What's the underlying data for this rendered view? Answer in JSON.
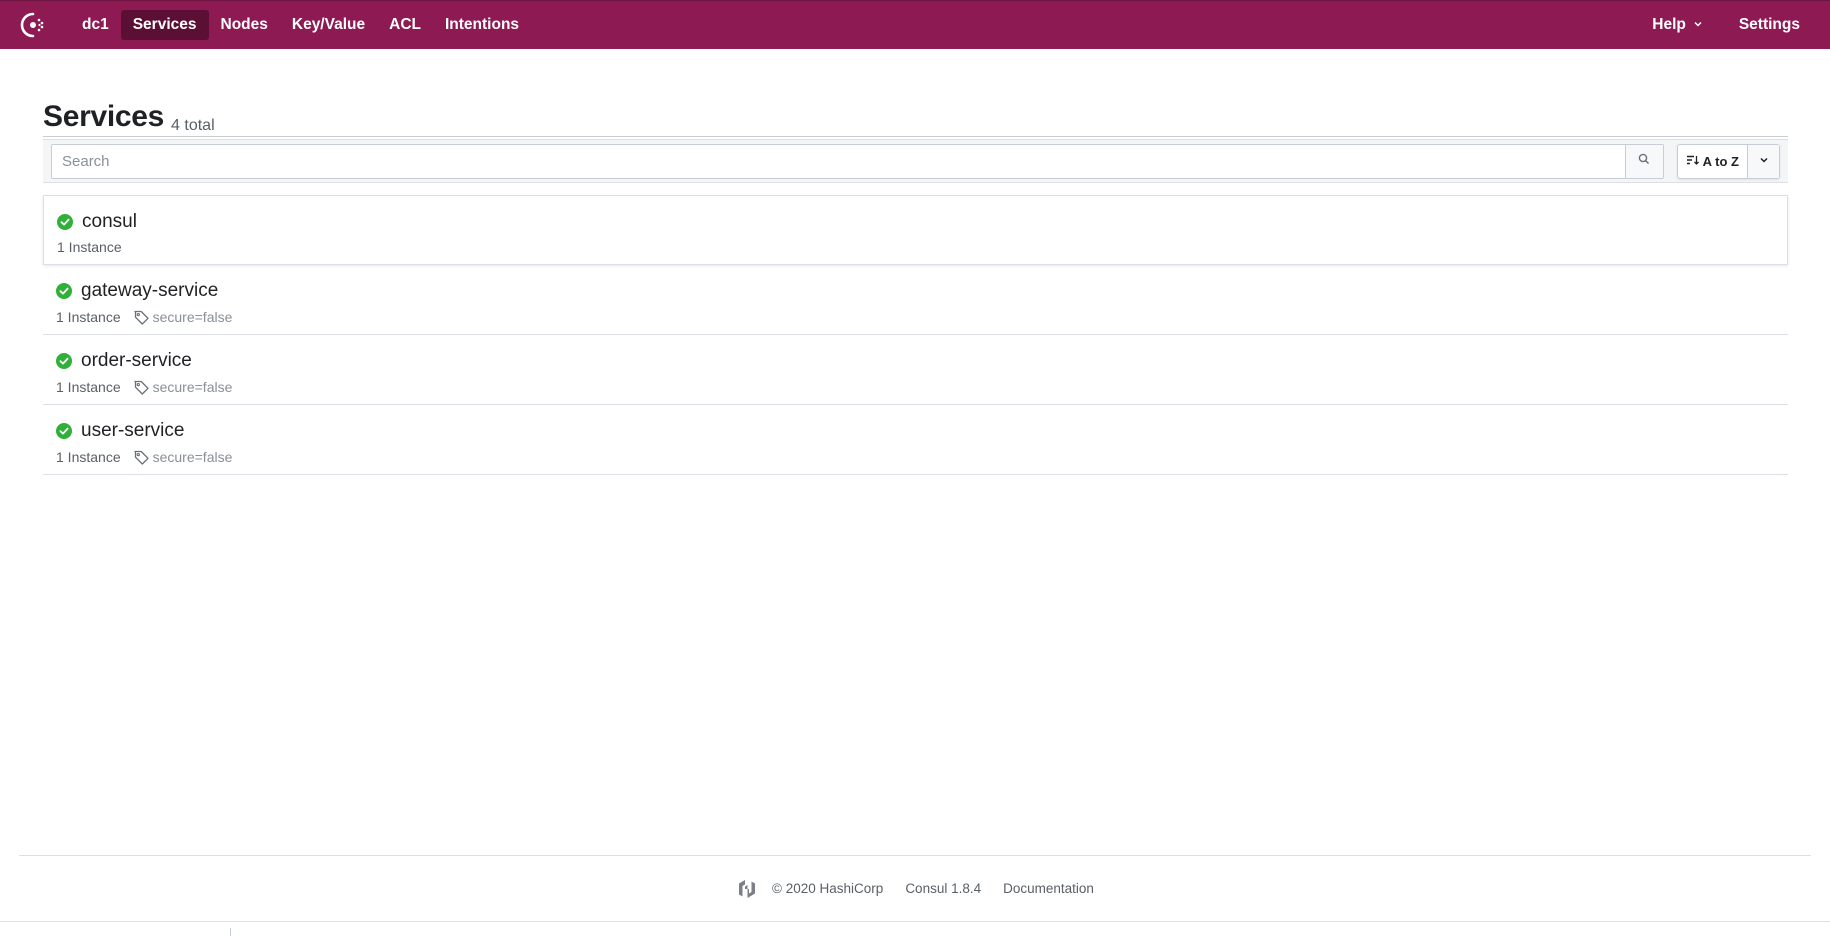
{
  "nav": {
    "datacenter": "dc1",
    "items": [
      {
        "label": "Services",
        "active": true
      },
      {
        "label": "Nodes",
        "active": false
      },
      {
        "label": "Key/Value",
        "active": false
      },
      {
        "label": "ACL",
        "active": false
      },
      {
        "label": "Intentions",
        "active": false
      }
    ],
    "help_label": "Help",
    "settings_label": "Settings",
    "brand_color": "#8e1a54"
  },
  "page": {
    "title": "Services",
    "total": "4 total"
  },
  "filter": {
    "search_placeholder": "Search",
    "search_value": "",
    "sort_label": "A to Z"
  },
  "services": [
    {
      "name": "consul",
      "status": "passing",
      "instances": "1 Instance",
      "tag": ""
    },
    {
      "name": "gateway-service",
      "status": "passing",
      "instances": "1 Instance",
      "tag": "secure=false"
    },
    {
      "name": "order-service",
      "status": "passing",
      "instances": "1 Instance",
      "tag": "secure=false"
    },
    {
      "name": "user-service",
      "status": "passing",
      "instances": "1 Instance",
      "tag": "secure=false"
    }
  ],
  "footer": {
    "copyright": "© 2020 HashiCorp",
    "version": "Consul 1.8.4",
    "docs_label": "Documentation"
  },
  "colors": {
    "passing": "#2eb039",
    "nav_active_bg": "#5c0f35"
  }
}
